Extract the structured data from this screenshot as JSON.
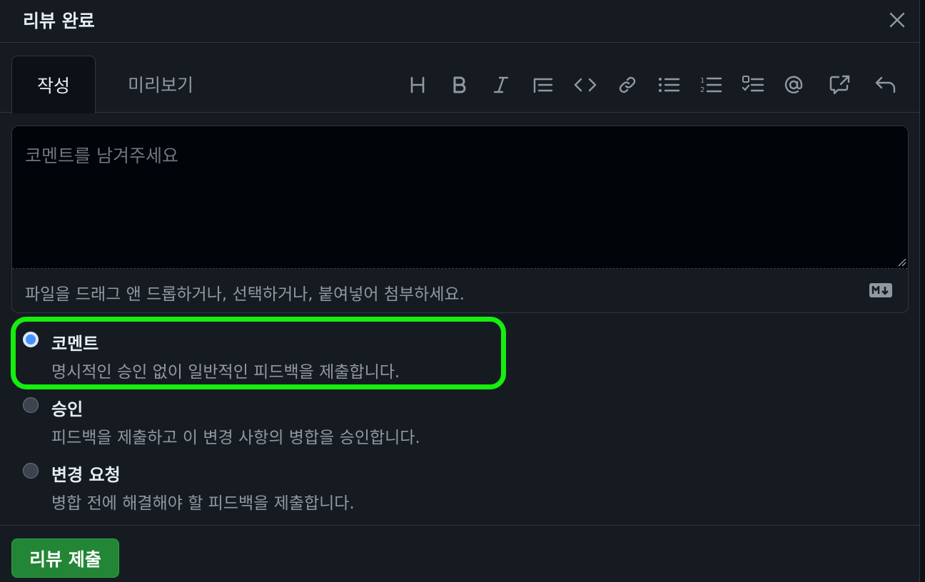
{
  "dialog": {
    "title": "리뷰 완료",
    "close_icon": "close-icon"
  },
  "tabs": {
    "write": "작성",
    "preview": "미리보기"
  },
  "toolbar": {
    "icons": [
      "heading-icon",
      "bold-icon",
      "italic-icon",
      "quote-icon",
      "code-icon",
      "link-icon",
      "unordered-list-icon",
      "ordered-list-icon",
      "task-list-icon",
      "mention-icon",
      "reference-icon",
      "undo-icon"
    ]
  },
  "editor": {
    "placeholder": "코멘트를 남겨주세요",
    "attach_hint": "파일을 드래그 앤 드롭하거나, 선택하거나, 붙여넣어 첨부하세요.",
    "markdown_icon": "markdown-icon"
  },
  "options": [
    {
      "title": "코멘트",
      "description": "명시적인 승인 없이 일반적인 피드백을 제출합니다.",
      "checked": true
    },
    {
      "title": "승인",
      "description": "피드백을 제출하고 이 변경 사항의 병합을 승인합니다.",
      "checked": false
    },
    {
      "title": "변경 요청",
      "description": "병합 전에 해결해야 할 피드백을 제출합니다.",
      "checked": false
    }
  ],
  "footer": {
    "submit_label": "리뷰 제출"
  },
  "colors": {
    "highlight": "#15ee0e",
    "submit": "#238636",
    "radio_checked": "#4493f8"
  }
}
